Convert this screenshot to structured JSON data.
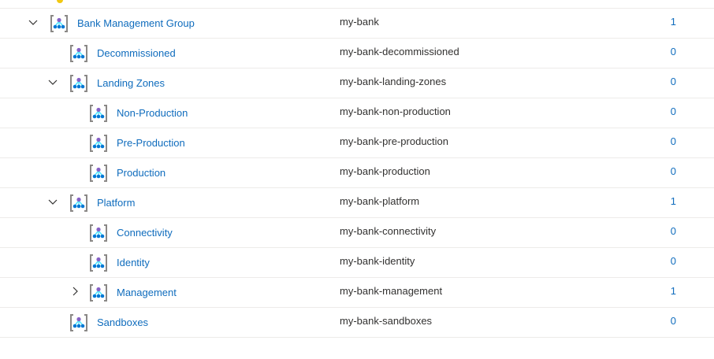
{
  "tree": {
    "rows": [
      {
        "name": "Bank Management Group",
        "id": "my-bank",
        "count": "1",
        "expand": "expanded"
      },
      {
        "name": "Decommissioned",
        "id": "my-bank-decommissioned",
        "count": "0",
        "expand": "none"
      },
      {
        "name": "Landing Zones",
        "id": "my-bank-landing-zones",
        "count": "0",
        "expand": "expanded"
      },
      {
        "name": "Non-Production",
        "id": "my-bank-non-production",
        "count": "0",
        "expand": "none"
      },
      {
        "name": "Pre-Production",
        "id": "my-bank-pre-production",
        "count": "0",
        "expand": "none"
      },
      {
        "name": "Production",
        "id": "my-bank-production",
        "count": "0",
        "expand": "none"
      },
      {
        "name": "Platform",
        "id": "my-bank-platform",
        "count": "1",
        "expand": "expanded"
      },
      {
        "name": "Connectivity",
        "id": "my-bank-connectivity",
        "count": "0",
        "expand": "none"
      },
      {
        "name": "Identity",
        "id": "my-bank-identity",
        "count": "0",
        "expand": "none"
      },
      {
        "name": "Management",
        "id": "my-bank-management",
        "count": "1",
        "expand": "collapsed"
      },
      {
        "name": "Sandboxes",
        "id": "my-bank-sandboxes",
        "count": "0",
        "expand": "none"
      }
    ],
    "icon": "management-group-icon",
    "colors": {
      "link": "#0f6cbd",
      "text": "#323130",
      "divider": "#edebe9",
      "icon_bracket": "#8a8886",
      "icon_node_top": "#8661c5",
      "icon_node_bottom": "#0078d4",
      "icon_lines": "#50e6ff"
    }
  }
}
